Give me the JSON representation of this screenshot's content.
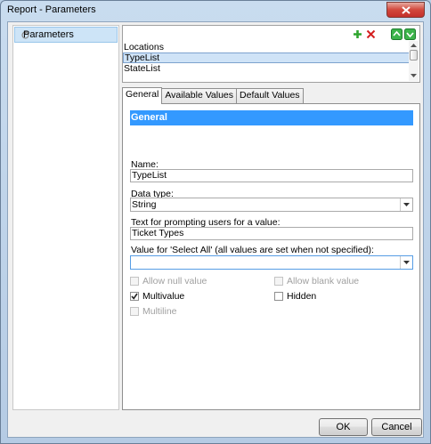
{
  "window": {
    "title": "Report - Parameters"
  },
  "nav": {
    "items": [
      {
        "label": "Parameters",
        "icon": "gear-icon"
      }
    ]
  },
  "parameters_list": {
    "items": [
      "Locations",
      "TypeList",
      "StateList"
    ],
    "selected": "TypeList"
  },
  "tabs": [
    {
      "label": "General",
      "active": true
    },
    {
      "label": "Available Values",
      "active": false
    },
    {
      "label": "Default Values",
      "active": false
    }
  ],
  "general": {
    "header": "General",
    "name_label": "Name:",
    "name_value": "TypeList",
    "datatype_label": "Data type:",
    "datatype_value": "String",
    "prompt_label": "Text for prompting users for a value:",
    "prompt_value": "Ticket Types",
    "selectall_label": "Value for 'Select All' (all values are set when not specified):",
    "selectall_value": "",
    "options": {
      "allow_null": {
        "label": "Allow null value",
        "checked": false,
        "enabled": false
      },
      "allow_blank": {
        "label": "Allow blank value",
        "checked": false,
        "enabled": false
      },
      "multivalue": {
        "label": "Multivalue",
        "checked": true,
        "enabled": true
      },
      "hidden": {
        "label": "Hidden",
        "checked": false,
        "enabled": true
      },
      "multiline": {
        "label": "Multiline",
        "checked": false,
        "enabled": false
      }
    }
  },
  "buttons": {
    "ok": "OK",
    "cancel": "Cancel"
  },
  "colors": {
    "accent": "#3399ff",
    "selection": "#cfe3f7",
    "add_icon": "#2fa52f",
    "delete_icon": "#d42020",
    "move_icon": "#2ea043"
  }
}
